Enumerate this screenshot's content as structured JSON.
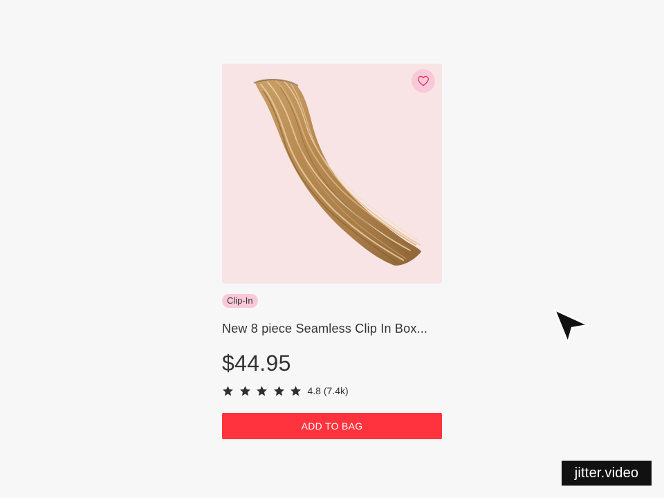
{
  "product": {
    "image_alt": "hair extension image",
    "badge": "Clip-In",
    "title": "New 8 piece Seamless Clip In Box...",
    "price": "$44.95",
    "rating": {
      "stars": 5,
      "text": "4.8 (7.4k)"
    },
    "add_to_bag_label": "ADD TO BAG"
  },
  "icons": {
    "wishlist": "heart-icon",
    "star": "star-icon",
    "cursor": "pointer-cursor-icon"
  },
  "colors": {
    "image_bg": "#f8e4e4",
    "badge_bg": "#f9c9da",
    "button_bg": "#ff333d",
    "heart_stroke": "#e0335a"
  },
  "watermark": "jitter.video"
}
